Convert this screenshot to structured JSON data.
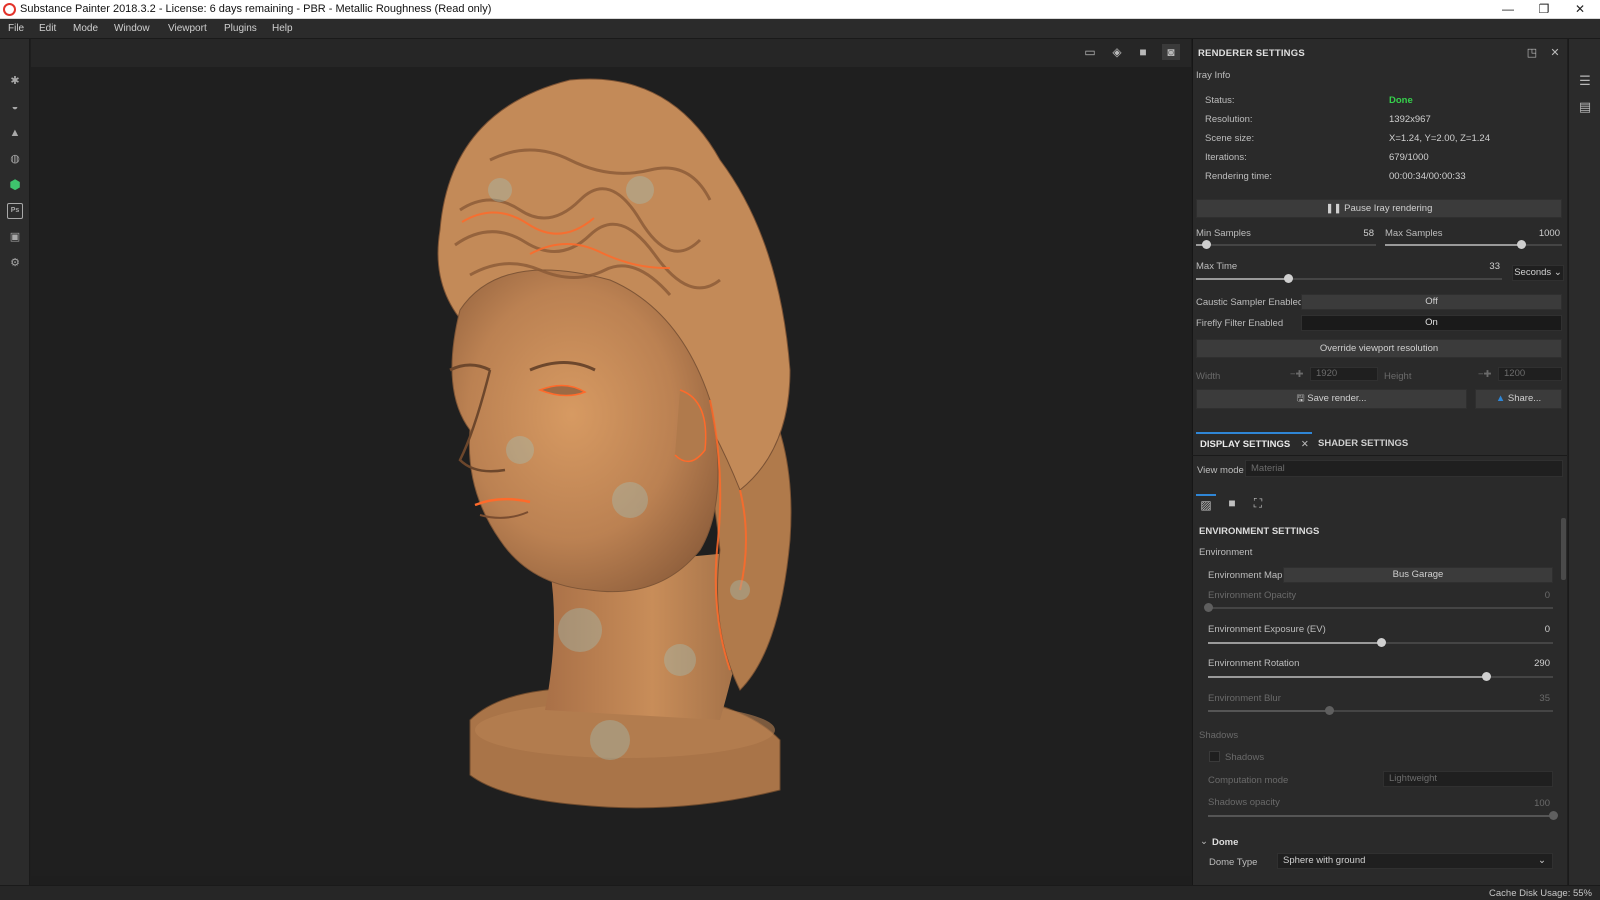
{
  "window": {
    "title": "Substance Painter 2018.3.2 - License: 6 days remaining - PBR - Metallic Roughness (Read only)",
    "minimize": "—",
    "maximize": "❐",
    "close": "✕"
  },
  "menu": [
    "File",
    "Edit",
    "Mode",
    "Window",
    "Viewport",
    "Plugins",
    "Help"
  ],
  "left_toolbar": {
    "icons": [
      "paint-brush-icon",
      "smudge-icon",
      "fill-icon",
      "clone-icon",
      "substance-icon",
      "photoshop-icon",
      "export-icon",
      "settings-icon"
    ],
    "ps_label": "Ps"
  },
  "renderer": {
    "header": "RENDERER SETTINGS",
    "iray_info": "Iray Info",
    "info_rows": [
      {
        "label": "Status:",
        "value": "Done"
      },
      {
        "label": "Resolution:",
        "value": "1392x967"
      },
      {
        "label": "Scene size:",
        "value": "X=1.24, Y=2.00, Z=1.24"
      },
      {
        "label": "Iterations:",
        "value": "679/1000"
      },
      {
        "label": "Rendering time:",
        "value": "00:00:34/00:00:33"
      }
    ],
    "pause_button": "Pause Iray rendering",
    "min_samples": {
      "label": "Min Samples",
      "value": "58",
      "min": 0,
      "max": 1000,
      "current": 58
    },
    "max_samples": {
      "label": "Max Samples",
      "value": "1000",
      "min": 0,
      "max": 1300,
      "current": 1000
    },
    "max_time": {
      "label": "Max Time",
      "value": "33",
      "unit": "Seconds",
      "min": 0,
      "max": 110,
      "current": 33
    },
    "caustic": {
      "label": "Caustic Sampler Enabled",
      "value": "Off"
    },
    "firefly": {
      "label": "Firefly Filter Enabled",
      "value": "On"
    },
    "override_button": "Override viewport resolution",
    "width": {
      "label": "Width",
      "value": "1920"
    },
    "height": {
      "label": "Height",
      "value": "1200"
    },
    "save_button": "Save render...",
    "share_button": "Share..."
  },
  "tabs": {
    "display": "DISPLAY SETTINGS",
    "shader": "SHADER SETTINGS"
  },
  "display": {
    "view_mode_label": "View mode",
    "view_mode_value": "Material",
    "env_title": "ENVIRONMENT SETTINGS",
    "env_group": "Environment",
    "env_map_label": "Environment Map",
    "env_map_value": "Bus Garage",
    "opacity": {
      "label": "Environment Opacity",
      "value": "0",
      "min": 0,
      "max": 100,
      "current": 0
    },
    "exposure": {
      "label": "Environment Exposure (EV)",
      "value": "0",
      "min": -12,
      "max": 12,
      "current": 0
    },
    "rotation": {
      "label": "Environment Rotation",
      "value": "290",
      "min": 0,
      "max": 360,
      "current": 290
    },
    "blur": {
      "label": "Environment Blur",
      "value": "35",
      "min": 0,
      "max": 100,
      "current": 35
    },
    "shadows_group": "Shadows",
    "shadows_check": "Shadows",
    "computation_label": "Computation mode",
    "computation_value": "Lightweight",
    "shadows_opacity": {
      "label": "Shadows opacity",
      "value": "100",
      "min": 0,
      "max": 100,
      "current": 100
    },
    "dome_title": "Dome",
    "dome_type_label": "Dome Type",
    "dome_type_value": "Sphere with ground"
  },
  "status": {
    "cache": "Cache Disk Usage:   55%"
  },
  "colors": {
    "accent": "#2f86d6",
    "status_done": "#36d04c",
    "brand_red": "#e3332b",
    "terracotta": "#c58a55",
    "highlight_orange": "#ff6a2a",
    "patina": "#9fc7c3"
  }
}
